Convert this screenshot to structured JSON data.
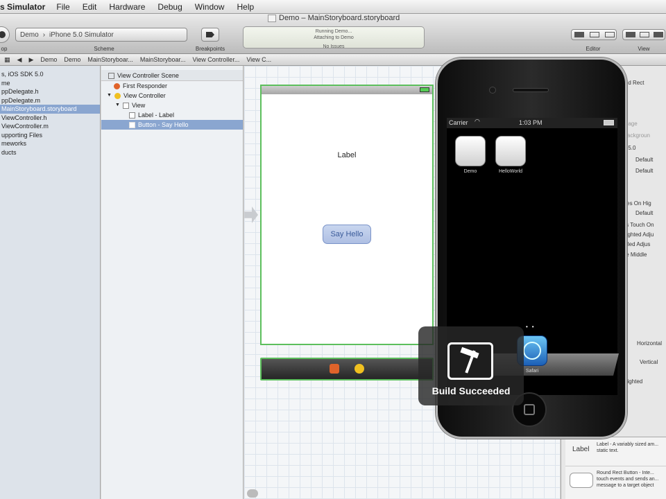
{
  "menubar": {
    "app_name": "s Simulator",
    "items": [
      "File",
      "Edit",
      "Hardware",
      "Debug",
      "Window",
      "Help"
    ]
  },
  "window": {
    "title": "Demo – MainStoryboard.storyboard"
  },
  "toolbar": {
    "run_label": "op",
    "scheme_target": "Demo",
    "scheme_destination": "iPhone 5.0 Simulator",
    "scheme_label": "Scheme",
    "breakpoints_label": "Breakpoints",
    "activity_lines": [
      "Running Demo...",
      "Attaching to Demo"
    ],
    "activity_footer": "No Issues",
    "editor_label": "Editor",
    "view_label": "View"
  },
  "jumpbar": {
    "crumbs": [
      "Demo",
      "Demo",
      "MainStoryboar...",
      "MainStoryboar...",
      "View Controller...",
      "View C..."
    ]
  },
  "navigator": {
    "items": [
      "s, iOS SDK 5.0",
      "me",
      "ppDelegate.h",
      "ppDelegate.m",
      "MainStoryboard.storyboard",
      "ViewController.h",
      "ViewController.m",
      "upporting Files",
      "meworks",
      "ducts"
    ],
    "selected_index": 4
  },
  "outline": {
    "header": "View Controller Scene",
    "rows": [
      "First Responder",
      "View Controller",
      "View",
      "Label - Label",
      "Button - Say Hello"
    ],
    "selected_index": 4
  },
  "canvas": {
    "label_text": "Label",
    "button_text": "Say Hello"
  },
  "simulator": {
    "carrier": "Carrier",
    "time": "1:03 PM",
    "apps": [
      "Demo",
      "HelloWorld"
    ],
    "dock_app": "Safari"
  },
  "hud": {
    "message": "Build Succeeded"
  },
  "inspector": {
    "rows": [
      "nded Rect",
      "ult",
      "ello",
      "t Image",
      "d Backgroun",
      "m 15.0",
      "Default",
      "Default",
      "erses On Hig",
      "Default",
      "ows Touch On",
      "ghlighted Adju",
      "sabled Adjus",
      "cale Middle",
      "ent",
      "Horizontal",
      "Vertical",
      "ighlighted"
    ]
  },
  "library": {
    "items": [
      {
        "title": "Label",
        "desc": "Label - A variably sized am... static text."
      },
      {
        "title": "Round Rect Button",
        "desc": "Round Rect Button - Inte... touch events and sends an... message to a target object"
      }
    ]
  }
}
